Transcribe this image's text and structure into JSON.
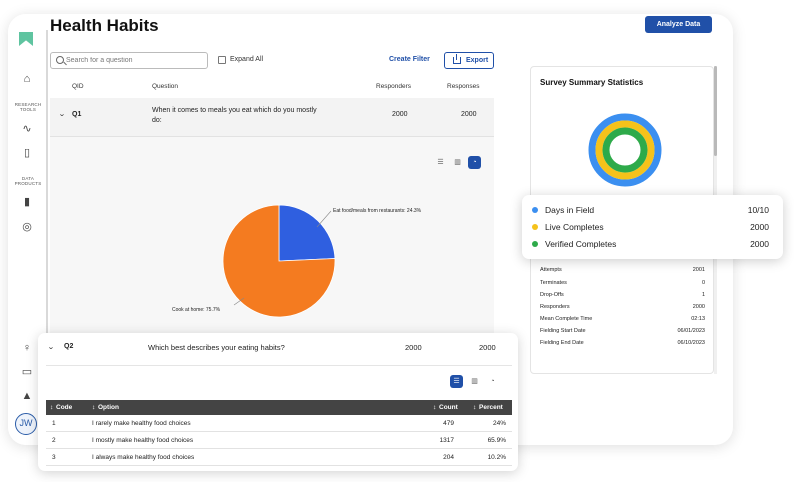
{
  "page": {
    "title": "Health Habits",
    "analyze_label": "Analyze Data"
  },
  "sidebar": {
    "research_tools_label": "RESEARCH TOOLS",
    "data_products_label": "DATA PRODUCTS",
    "user_initials": "JW"
  },
  "toolbar": {
    "search_placeholder": "Search for a question",
    "expand_all_label": "Expand All",
    "create_filter_label": "Create Filter",
    "export_label": "Export"
  },
  "columns": {
    "qid": "QID",
    "question": "Question",
    "responders": "Responders",
    "responses": "Responses"
  },
  "q1": {
    "id": "Q1",
    "text": "When it comes to meals you eat which do you mostly do:",
    "responders": "2000",
    "responses": "2000",
    "chart_data": {
      "type": "pie",
      "slices": [
        {
          "label": "Eat food/meals from restaurants",
          "value": 24.3,
          "display": "Eat food/meals from restaurants: 24.3%",
          "color": "#2f5fe0"
        },
        {
          "label": "Cook at home",
          "value": 75.7,
          "display": "Cook at home: 75.7%",
          "color": "#f47b20"
        }
      ]
    }
  },
  "q2": {
    "id": "Q2",
    "text": "Which best describes your eating habits?",
    "responders": "2000",
    "responses": "2000",
    "table": {
      "headers": {
        "code": "Code",
        "option": "Option",
        "count": "Count",
        "percent": "Percent"
      },
      "rows": [
        {
          "code": "1",
          "option": "I rarely make healthy food choices",
          "count": "479",
          "percent": "24%"
        },
        {
          "code": "2",
          "option": "I mostly make healthy food choices",
          "count": "1317",
          "percent": "65.9%"
        },
        {
          "code": "3",
          "option": "I always make healthy food choices",
          "count": "204",
          "percent": "10.2%"
        }
      ]
    }
  },
  "summary": {
    "title": "Survey Summary Statistics",
    "legend": [
      {
        "label": "Days in Field",
        "value": "10/10",
        "color": "#3b8ff0"
      },
      {
        "label": "Live Completes",
        "value": "2000",
        "color": "#f5c21b"
      },
      {
        "label": "Verified Completes",
        "value": "2000",
        "color": "#2eaa4a"
      }
    ],
    "stats": [
      {
        "label": "Attempts",
        "value": "2001"
      },
      {
        "label": "Terminates",
        "value": "0"
      },
      {
        "label": "Drop-Offs",
        "value": "1"
      },
      {
        "label": "Responders",
        "value": "2000"
      },
      {
        "label": "Mean Complete Time",
        "value": "02:13"
      },
      {
        "label": "Fielding Start Date",
        "value": "06/01/2023"
      },
      {
        "label": "Fielding End Date",
        "value": "06/10/2023"
      }
    ]
  }
}
